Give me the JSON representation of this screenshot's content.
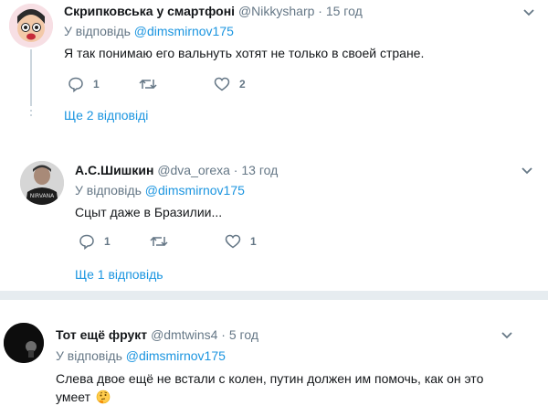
{
  "tweets": [
    {
      "name": "Скрипковська у смартфоні",
      "handle": "@Nikkysharp",
      "dot": "·",
      "time": "15 год",
      "reply_prefix": "У відповідь ",
      "reply_mention": "@dimsmirnov175",
      "text": "Я так понимаю его вальнуть хотят не только в своей стране.",
      "reply_count": "1",
      "retweet_count": "",
      "like_count": "2",
      "more_replies": "Ще 2 відповіді"
    },
    {
      "name": "А.С.Шишкин",
      "handle": "@dva_orexa",
      "dot": "·",
      "time": "13 год",
      "reply_prefix": "У відповідь ",
      "reply_mention": "@dimsmirnov175",
      "text": "Сцыт даже в Бразилии...",
      "reply_count": "1",
      "retweet_count": "",
      "like_count": "1",
      "more_replies": "Ще 1 відповідь"
    },
    {
      "name": "Тот ещё фрукт",
      "handle": "@dmtwins4",
      "dot": "·",
      "time": "5 год",
      "reply_prefix": "У відповідь ",
      "reply_mention": "@dimsmirnov175",
      "text": "Слева двое ещё не встали с колен, путин должен им помочь, как он это умеет"
    }
  ],
  "icons": {
    "reply": "reply-icon",
    "retweet": "retweet-icon",
    "like": "heart-icon",
    "menu": "chevron-down-icon",
    "emoji": "thinking-face-emoji"
  },
  "colors": {
    "link": "#1b95e0",
    "secondary": "#657786",
    "separator": "#e6ecf0"
  }
}
